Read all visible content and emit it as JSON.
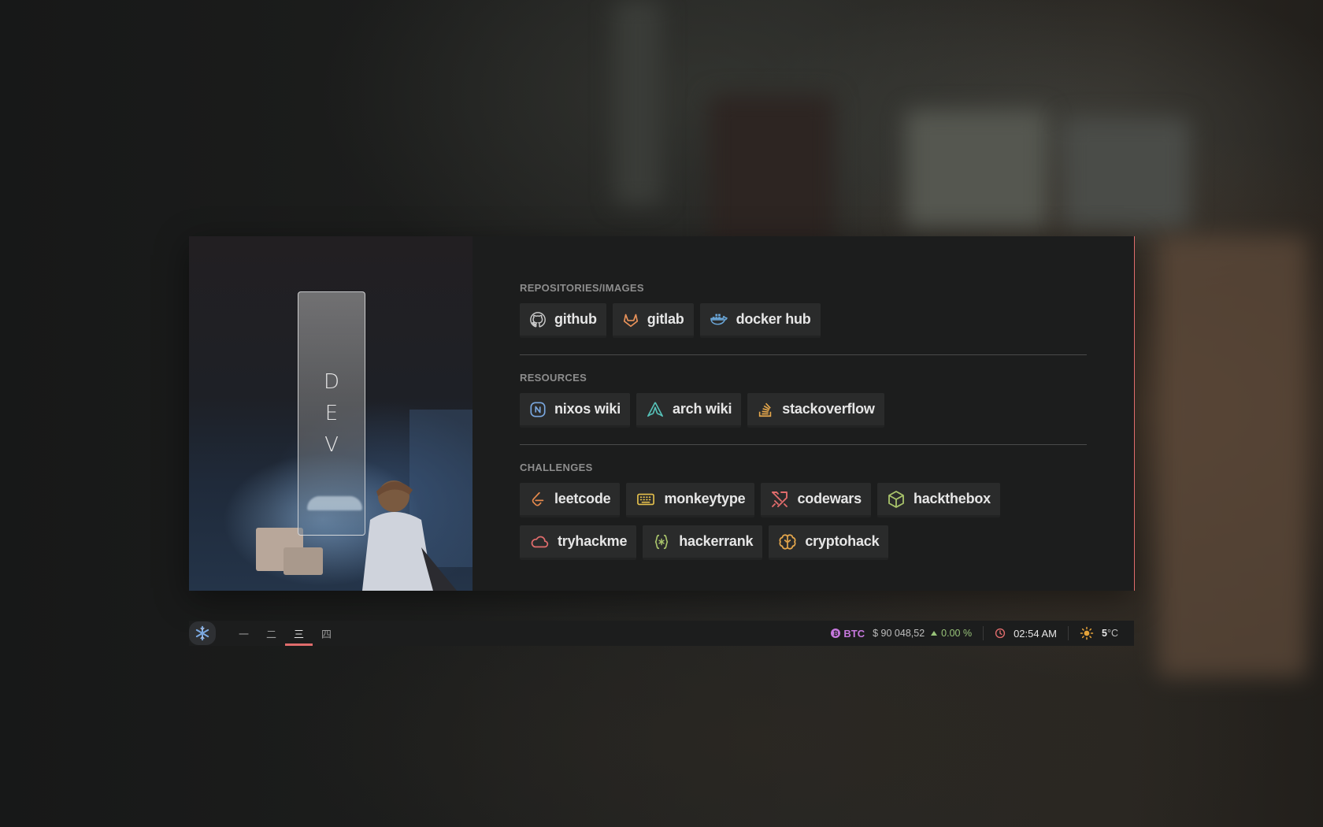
{
  "hero": {
    "label": "DEV"
  },
  "sections": [
    {
      "title": "REPOSITORIES/IMAGES",
      "links": [
        {
          "label": "github",
          "icon": "github-icon",
          "color": "#c9c9c9"
        },
        {
          "label": "gitlab",
          "icon": "gitlab-icon",
          "color": "#e9925a"
        },
        {
          "label": "docker hub",
          "icon": "docker-icon",
          "color": "#6aa6d8"
        }
      ]
    },
    {
      "title": "RESOURCES",
      "links": [
        {
          "label": "nixos wiki",
          "icon": "nixos-icon",
          "color": "#7aa8e0"
        },
        {
          "label": "arch wiki",
          "icon": "arch-icon",
          "color": "#56c1b8"
        },
        {
          "label": "stackoverflow",
          "icon": "stackoverflow-icon",
          "color": "#e5a74c"
        }
      ]
    },
    {
      "title": "CHALLENGES",
      "links": [
        {
          "label": "leetcode",
          "icon": "leetcode-icon",
          "color": "#e5894c"
        },
        {
          "label": "monkeytype",
          "icon": "keyboard-icon",
          "color": "#e5c04c"
        },
        {
          "label": "codewars",
          "icon": "swords-icon",
          "color": "#e06c6c"
        },
        {
          "label": "hackthebox",
          "icon": "cube-icon",
          "color": "#a9c46b"
        },
        {
          "label": "tryhackme",
          "icon": "cloud-icon",
          "color": "#e06c6c"
        },
        {
          "label": "hackerrank",
          "icon": "braces-icon",
          "color": "#a9c46b"
        },
        {
          "label": "cryptohack",
          "icon": "brain-icon",
          "color": "#e5a74c"
        }
      ]
    }
  ],
  "bar": {
    "workspaces": [
      "一",
      "二",
      "三",
      "四"
    ],
    "active_workspace": 2,
    "btc_symbol": "₿",
    "btc_label": "BTC",
    "btc_price": "$ 90 048,52",
    "btc_change": "0.00 %",
    "time": "02:54 AM",
    "temp": "5",
    "temp_unit": "°C"
  },
  "colors": {
    "accent": "#e06c6c",
    "btc": "#c678dd",
    "positive": "#98c379",
    "sun": "#e5a33a",
    "panel": "#1c1d1d",
    "chip": "#2a2b2b"
  }
}
